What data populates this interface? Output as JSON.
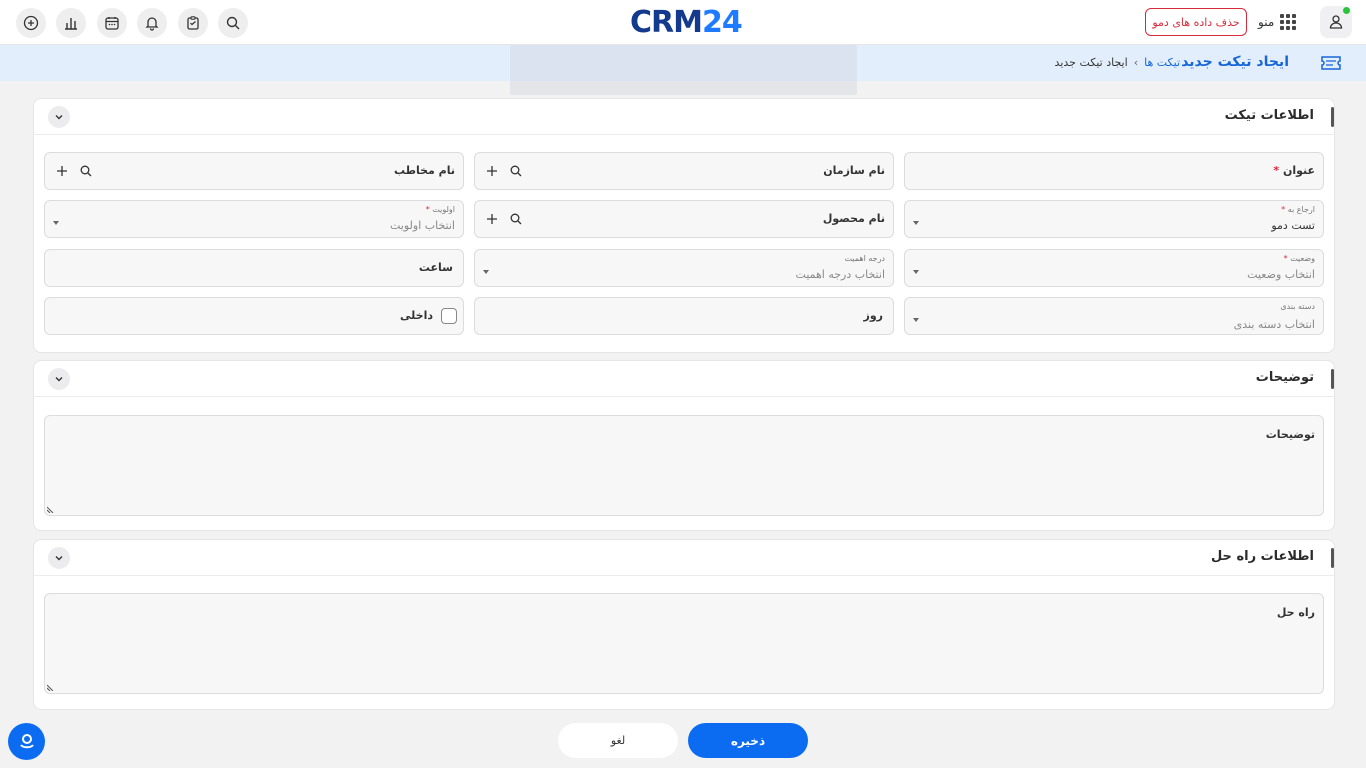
{
  "topbar": {
    "logo_part1": "CRM",
    "logo_part2": "24",
    "delete_demo_label": "حذف داده های دمو",
    "menu_label": "منو",
    "left_icons": [
      "add-circle-icon",
      "bar-chart-icon",
      "calendar-icon",
      "bell-icon",
      "clipboard-icon",
      "search-icon"
    ]
  },
  "subheader": {
    "page_title": "ایجاد تیکت جدید",
    "breadcrumb": {
      "link": "تیکت ها",
      "separator": "›",
      "current": "ایجاد تیکت جدید"
    }
  },
  "ticket_info": {
    "title": "اطلاعات تیکت",
    "subject_label": "عنوان",
    "required_mark": "*",
    "organization_label": "نام سازمان",
    "contact_label": "نام مخاطب",
    "assign_label": "ارجاع به",
    "assign_value": "تست دمو",
    "product_label": "نام محصول",
    "priority_label": "اولویت",
    "priority_placeholder": "انتخاب اولویت",
    "status_label": "وضعیت",
    "status_placeholder": "انتخاب وضعیت",
    "importance_label": "درجه اهمیت",
    "importance_placeholder": "انتخاب درجه اهمیت",
    "hour_label": "ساعت",
    "category_label": "دسته بندی",
    "category_placeholder": "انتخاب دسته بندی",
    "day_label": "روز",
    "internal_label": "داخلی"
  },
  "description": {
    "title": "توضیحات",
    "field_label": "توضیحات"
  },
  "solution": {
    "title": "اطلاعات راه حل",
    "field_label": "راه حل"
  },
  "footer": {
    "save_label": "ذخیره",
    "cancel_label": "لغو"
  },
  "colors": {
    "primary": "#0b6cf2",
    "title_blue": "#1766d6",
    "danger": "#d82b3a",
    "online": "#27c43c"
  }
}
